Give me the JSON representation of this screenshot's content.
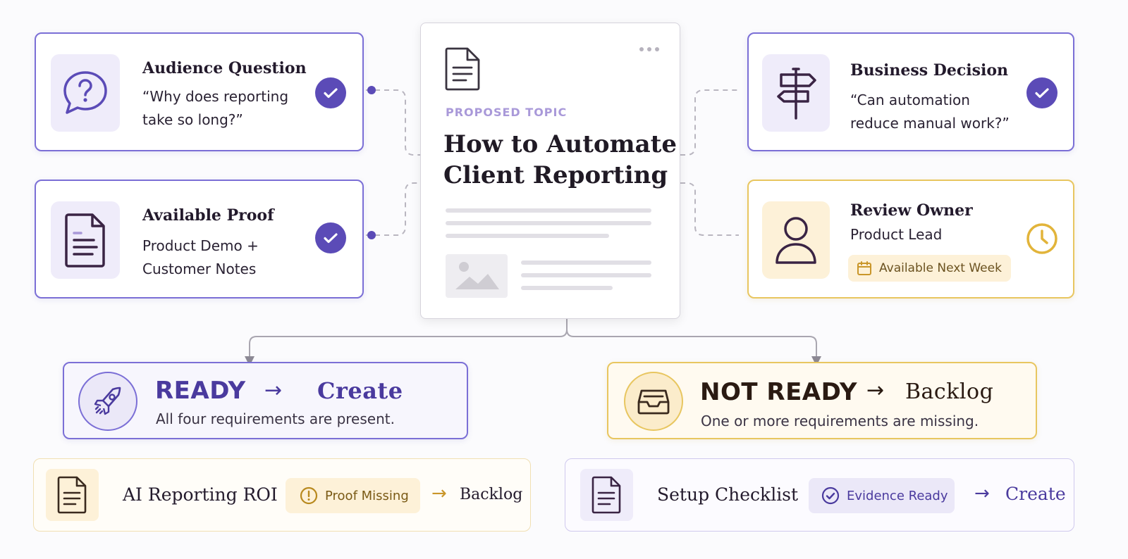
{
  "center": {
    "eyebrow": "PROPOSED TOPIC",
    "title_line1": "How to Automate",
    "title_line2": "Client Reporting"
  },
  "requirements": {
    "audience": {
      "title": "Audience Question",
      "line1": "“Why does reporting",
      "line2": "take so long?”"
    },
    "proof": {
      "title": "Available Proof",
      "line1": "Product Demo +",
      "line2": "Customer Notes"
    },
    "decision": {
      "title": "Business Decision",
      "line1": "“Can automation",
      "line2": "reduce manual work?”"
    },
    "owner": {
      "title": "Review Owner",
      "line1": "Product Lead",
      "badge": "Available Next Week"
    }
  },
  "outcomes": {
    "ready": {
      "status": "READY",
      "arrow": "→",
      "action": "Create",
      "subtitle": "All four requirements are present."
    },
    "not_ready": {
      "status": "NOT READY",
      "arrow": "→",
      "action": "Backlog",
      "subtitle": "One or more requirements are missing."
    }
  },
  "examples": {
    "roi": {
      "title": "AI Reporting ROI",
      "badge": "Proof Missing",
      "arrow": "→",
      "action": "Backlog"
    },
    "setup": {
      "title": "Setup Checklist",
      "badge": "Evidence Ready",
      "arrow": "→",
      "action": "Create"
    }
  },
  "colors": {
    "purple": "#5b4bb7",
    "purple_border": "#7b6fd6",
    "gold": "#e2b43a",
    "gold_border": "#e8c660"
  },
  "icons": {
    "audience": "question-bubble-icon",
    "proof": "document-icon",
    "decision": "signpost-icon",
    "owner": "person-icon",
    "ready": "rocket-icon",
    "not_ready": "inbox-tray-icon"
  }
}
